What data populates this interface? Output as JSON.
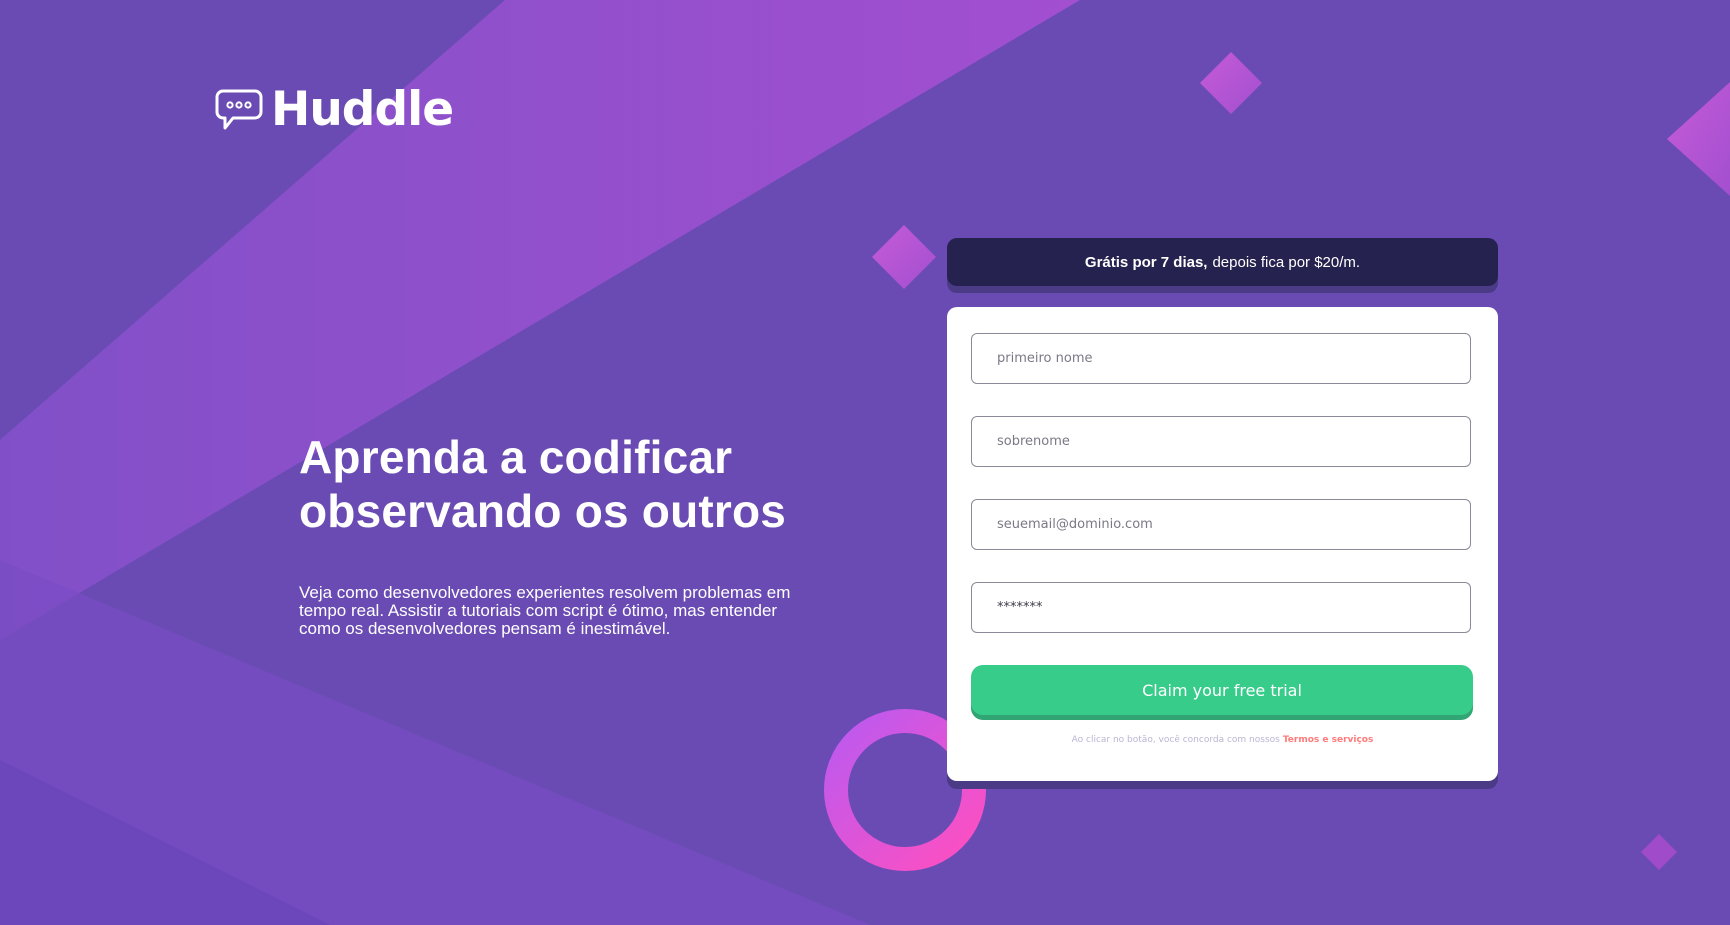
{
  "brand": {
    "name": "Huddle",
    "icon": "chat-bubble-icon"
  },
  "hero": {
    "title_line1": "Aprenda a codificar",
    "title_line2": "observando os outros",
    "description": "Veja como desenvolvedores experientes resolvem problemas em tempo real. Assistir a tutoriais com script é ótimo, mas entender como os desenvolvedores pensam é inestimável."
  },
  "offer": {
    "bold": "Grátis por 7 dias,",
    "rest": "depois fica por $20/m."
  },
  "form": {
    "first_name_placeholder": "primeiro nome",
    "last_name_placeholder": "sobrenome",
    "email_placeholder": "seuemail@dominio.com",
    "password_value": "*******",
    "submit_label": "Claim your free trial",
    "terms_prefix": "Ao clicar no botão, você concorda com nossos",
    "terms_link": "Termos e serviços"
  },
  "colors": {
    "background": "#6a4bb3",
    "offer_bar": "#26224f",
    "cta": "#38cc8b",
    "cta_shadow": "#31a574",
    "terms_link": "#ff7a7a"
  }
}
